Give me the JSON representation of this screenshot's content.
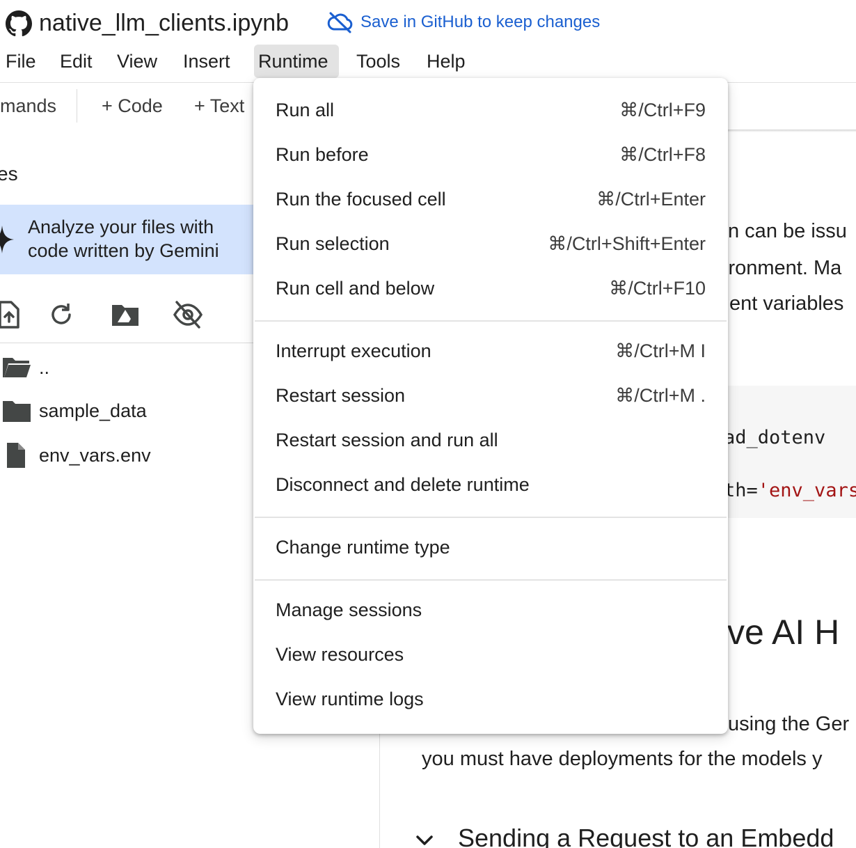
{
  "header": {
    "notebook_title": "native_llm_clients.ipynb",
    "save_link": "Save in GitHub to keep changes"
  },
  "menubar": {
    "items": [
      "File",
      "Edit",
      "View",
      "Insert",
      "Runtime",
      "Tools",
      "Help"
    ],
    "active": "Runtime"
  },
  "toolbar": {
    "commands_partial": "mands",
    "add_code": "+ Code",
    "add_text": "+ Text"
  },
  "sidebar": {
    "heading_partial": "es",
    "gemini_banner_line1": "Analyze your files with",
    "gemini_banner_line2": "code written by Gemini",
    "files": [
      {
        "name": "..",
        "icon": "folder-open-icon"
      },
      {
        "name": "sample_data",
        "icon": "folder-icon"
      },
      {
        "name": "env_vars.env",
        "icon": "file-icon"
      }
    ]
  },
  "content": {
    "line1": "n can be issu",
    "line2": "ironment. Ma",
    "line3": "ent variables",
    "code_line1": "ad_dotenv",
    "code_line2_prefix": "th=",
    "code_line2_str": "'env_vars",
    "heading": "tive AI H",
    "para_line1": "using the Ger",
    "para_line2": "you must have deployments for the models y",
    "section_heading": "Sending a Request to an Embedd"
  },
  "runtime_menu": {
    "groups": [
      [
        {
          "label": "Run all",
          "shortcut": "⌘/Ctrl+F9"
        },
        {
          "label": "Run before",
          "shortcut": "⌘/Ctrl+F8"
        },
        {
          "label": "Run the focused cell",
          "shortcut": "⌘/Ctrl+Enter"
        },
        {
          "label": "Run selection",
          "shortcut": "⌘/Ctrl+Shift+Enter"
        },
        {
          "label": "Run cell and below",
          "shortcut": "⌘/Ctrl+F10"
        }
      ],
      [
        {
          "label": "Interrupt execution",
          "shortcut": "⌘/Ctrl+M I"
        },
        {
          "label": "Restart session",
          "shortcut": "⌘/Ctrl+M ."
        },
        {
          "label": "Restart session and run all",
          "shortcut": ""
        },
        {
          "label": "Disconnect and delete runtime",
          "shortcut": ""
        }
      ],
      [
        {
          "label": "Change runtime type",
          "shortcut": ""
        }
      ],
      [
        {
          "label": "Manage sessions",
          "shortcut": ""
        },
        {
          "label": "View resources",
          "shortcut": ""
        },
        {
          "label": "View runtime logs",
          "shortcut": ""
        }
      ]
    ]
  },
  "colors": {
    "link": "#1a5fd0",
    "banner": "#d3e3fd",
    "active_menu": "#e3e3e3",
    "code_string": "#a31515"
  }
}
